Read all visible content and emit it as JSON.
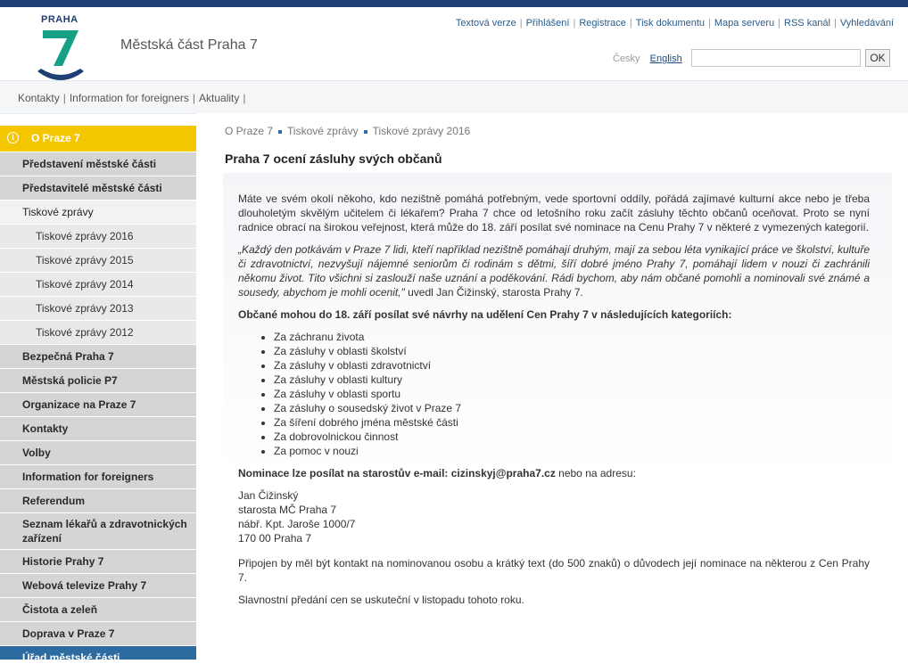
{
  "header": {
    "logo_text": "PRAHA",
    "site_title": "Městská část Praha 7",
    "top_links": [
      "Textová verze",
      "Přihlášení",
      "Registrace",
      "Tisk dokumentu",
      "Mapa serveru",
      "RSS kanál",
      "Vyhledávání"
    ],
    "lang_cz": "Česky",
    "lang_en": "English",
    "search_placeholder": "",
    "search_button": "OK"
  },
  "subnav": [
    "Kontakty",
    "Information for foreigners",
    "Aktuality"
  ],
  "sidebar": {
    "head": "O Praze 7",
    "items": [
      {
        "label": "Představení městské části",
        "kind": "main"
      },
      {
        "label": "Představitelé městské části",
        "kind": "main"
      },
      {
        "label": "Tiskové zprávy",
        "kind": "active"
      },
      {
        "label": "Tiskové zprávy 2016",
        "kind": "sub"
      },
      {
        "label": "Tiskové zprávy 2015",
        "kind": "sub"
      },
      {
        "label": "Tiskové zprávy 2014",
        "kind": "sub"
      },
      {
        "label": "Tiskové zprávy 2013",
        "kind": "sub"
      },
      {
        "label": "Tiskové zprávy 2012",
        "kind": "sub"
      },
      {
        "label": "Bezpečná Praha 7",
        "kind": "main"
      },
      {
        "label": "Městská policie P7",
        "kind": "main"
      },
      {
        "label": "Organizace na Praze 7",
        "kind": "main"
      },
      {
        "label": "Kontakty",
        "kind": "main"
      },
      {
        "label": "Volby",
        "kind": "main"
      },
      {
        "label": "Information for foreigners",
        "kind": "main"
      },
      {
        "label": "Referendum",
        "kind": "main"
      },
      {
        "label": "Seznam lékařů a zdravotnických zařízení",
        "kind": "tall"
      },
      {
        "label": "Historie Prahy 7",
        "kind": "main"
      },
      {
        "label": "Webová televize Prahy 7",
        "kind": "main"
      },
      {
        "label": "Čistota a zeleň",
        "kind": "main"
      },
      {
        "label": "Doprava v Praze 7",
        "kind": "main"
      },
      {
        "label": "Úřad městské části",
        "kind": "blue"
      }
    ]
  },
  "breadcrumb": [
    "O Praze 7",
    "Tiskové zprávy",
    "Tiskové zprávy 2016"
  ],
  "page_title": "Praha 7 ocení zásluhy svých občanů",
  "article": {
    "p1": "Máte ve svém okolí někoho, kdo nezištně pomáhá potřebným, vede sportovní oddíly, pořádá zajímavé kulturní akce nebo je třeba dlouholetým skvělým učitelem či lékařem? Praha 7 chce od letošního roku začít zásluhy těchto občanů oceňovat. Proto se nyní radnice obrací na širokou veřejnost, která může do 18. září posílat své nominace na Cenu Prahy 7 v některé z vymezených kategorií.",
    "quote": "„Každý den potkávám v Praze 7 lidi, kteří například nezištně pomáhají druhým, mají za sebou léta vynikající práce ve školství, kultuře či zdravotnictví, nezvyšují nájemné seniorům či rodinám s dětmi, šíří dobré jméno Prahy 7, pomáhají lidem v nouzi či zachránili někomu život. Tito všichni si zaslouží naše uznání a poděkování. Rádi bychom, aby nám občané pomohli a nominovali své známé a sousedy, abychom je mohli ocenit,\"",
    "quote_author": " uvedl Jan Čižinský, starosta Prahy 7.",
    "categories_heading": "Občané mohou do 18. září posílat své návrhy na udělení Cen Prahy 7 v následujících kategoriích:",
    "categories": [
      "Za záchranu života",
      "Za zásluhy v oblasti školství",
      "Za zásluhy v oblasti zdravotnictví",
      "Za zásluhy v oblasti kultury",
      "Za zásluhy v oblasti sportu",
      "Za zásluhy o sousedský život v Praze 7",
      "Za šíření dobrého jména městské části",
      "Za dobrovolnickou činnost",
      "Za pomoc v nouzi"
    ],
    "nomination_bold": "Nominace lze posílat na starostův e-mail: cizinskyj@praha7.cz",
    "nomination_rest": " nebo na adresu:",
    "address": [
      "Jan Čižinský",
      "starosta MČ Praha 7",
      "nábř. Kpt. Jaroše 1000/7",
      "170 00 Praha 7"
    ],
    "p_attach": "Připojen by měl být kontakt na nominovanou osobu a krátký text (do 500 znaků) o důvodech její nominace na některou z Cen Prahy 7.",
    "p_final": "Slavnostní předání cen se uskuteční v listopadu tohoto roku."
  },
  "colors": {
    "navy": "#1d3f72",
    "green": "#16a085",
    "yellow": "#f3c600",
    "link": "#2b5c8a"
  }
}
